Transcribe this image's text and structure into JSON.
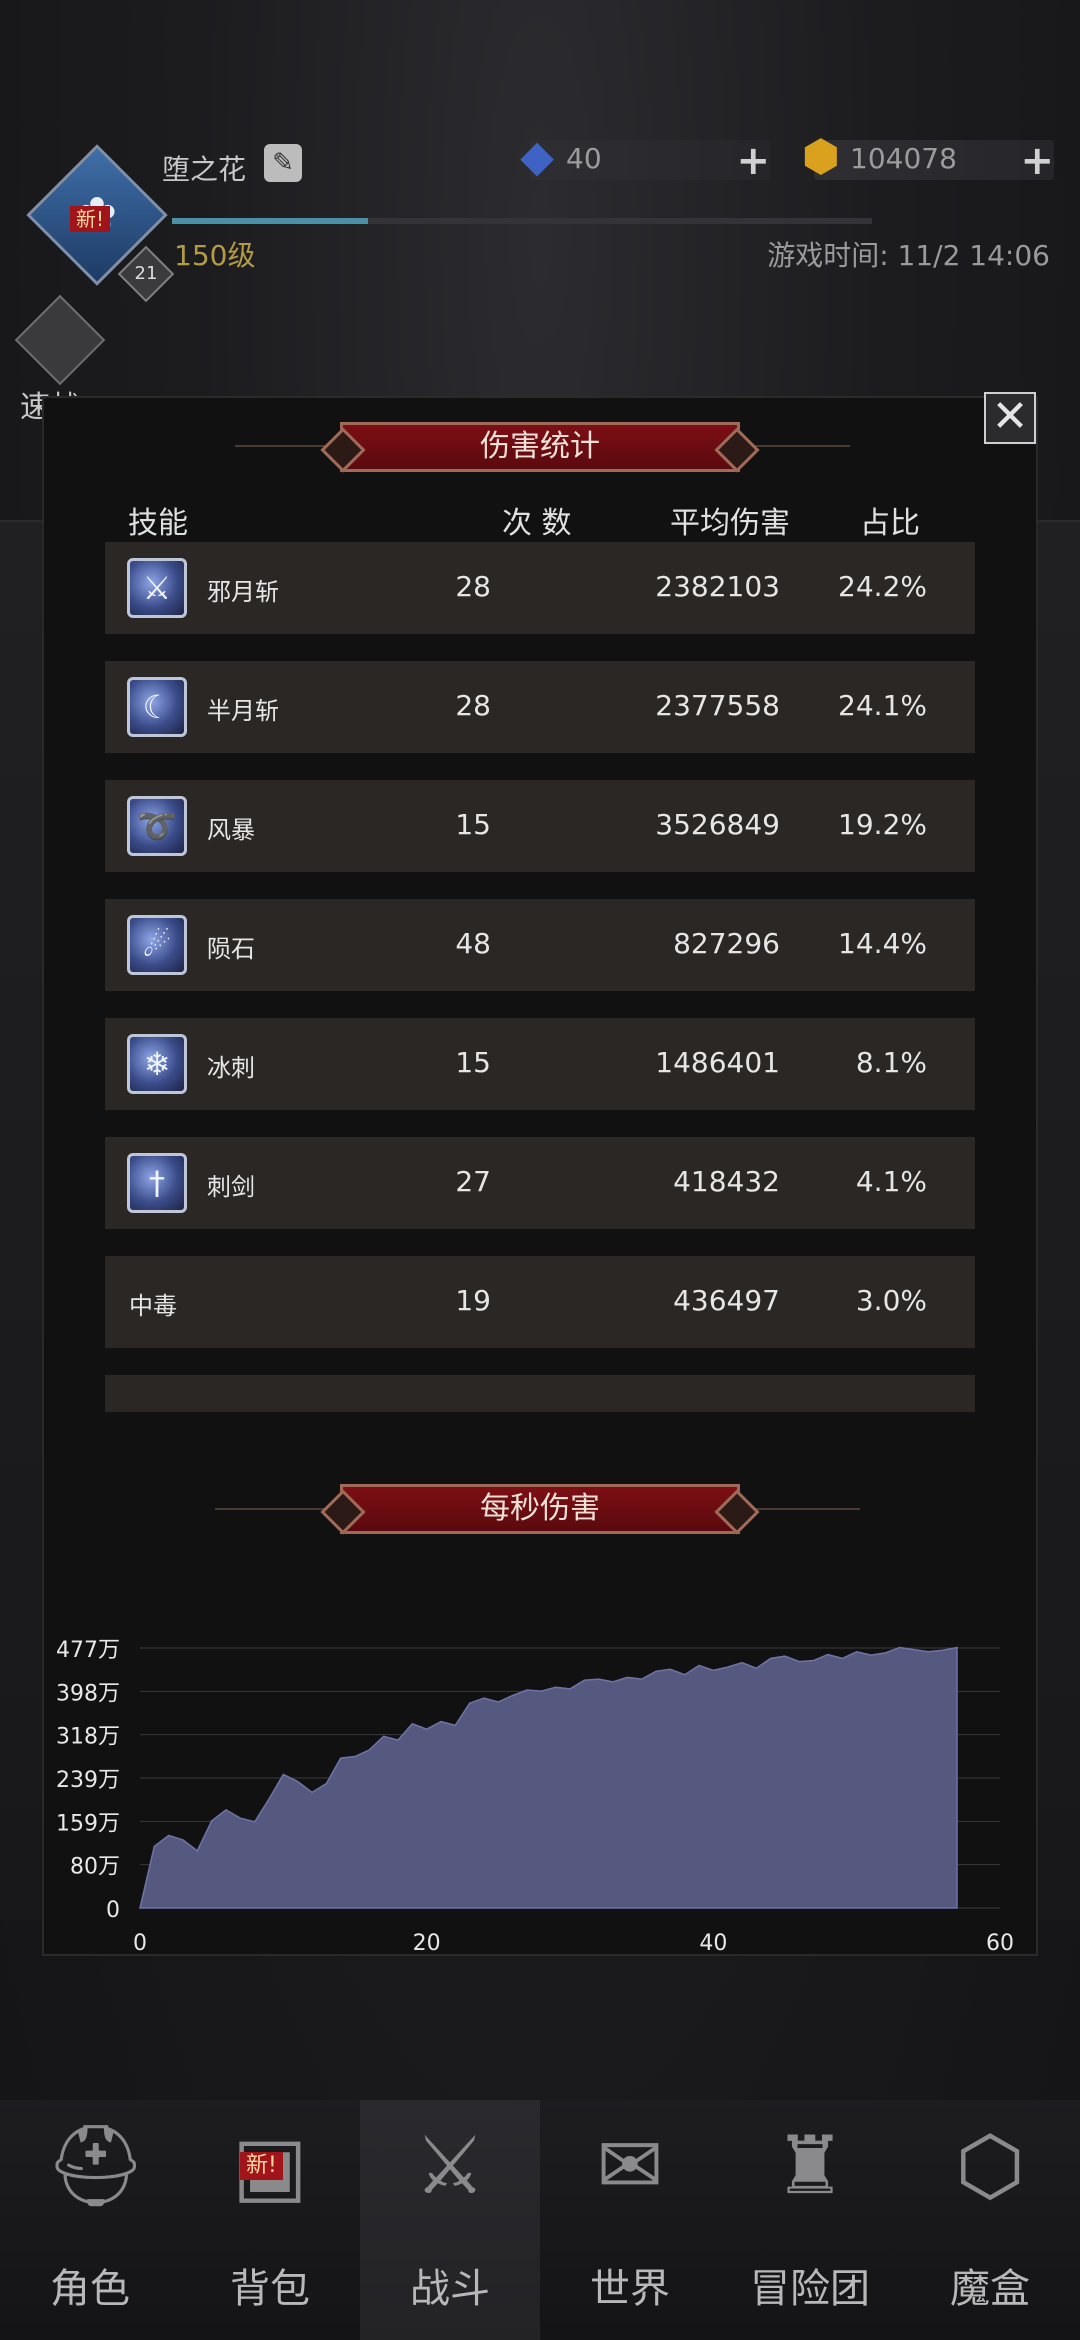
{
  "header": {
    "player_name": "堕之花",
    "player_level": "150级",
    "avatar_new_tag": "新!",
    "avatar_badge": "21",
    "exp_fraction": 0.28,
    "game_time": "游戏时间: 11/2 14:06",
    "currency": [
      {
        "icon": "blue-gem-icon",
        "amount": "40"
      },
      {
        "icon": "gold-gem-icon",
        "amount": "104078"
      }
    ],
    "speed_battle_label": "速战"
  },
  "damage_stats": {
    "title": "伤害统计",
    "columns": {
      "skill": "技能",
      "count": "次 数",
      "avg": "平均伤害",
      "pct": "占比"
    },
    "rows": [
      {
        "name": "邪月斩",
        "icon": "sword-slash-icon",
        "count": "28",
        "avg": "2382103",
        "pct": "24.2%"
      },
      {
        "name": "半月斩",
        "icon": "crescent-moon-icon",
        "count": "28",
        "avg": "2377558",
        "pct": "24.1%"
      },
      {
        "name": "风暴",
        "icon": "storm-icon",
        "count": "15",
        "avg": "3526849",
        "pct": "19.2%"
      },
      {
        "name": "陨石",
        "icon": "meteor-icon",
        "count": "48",
        "avg": "827296",
        "pct": "14.4%"
      },
      {
        "name": "冰刺",
        "icon": "ice-spike-icon",
        "count": "15",
        "avg": "1486401",
        "pct": "8.1%"
      },
      {
        "name": "刺剑",
        "icon": "rapier-icon",
        "count": "27",
        "avg": "418432",
        "pct": "4.1%"
      },
      {
        "name": "中毒",
        "icon": "",
        "count": "19",
        "avg": "436497",
        "pct": "3.0%"
      }
    ]
  },
  "dps": {
    "title": "每秒伤害"
  },
  "chart_data": {
    "type": "area",
    "title": "每秒伤害",
    "xlabel": "",
    "ylabel": "",
    "xlim": [
      0,
      60
    ],
    "ylim": [
      0,
      477
    ],
    "x_ticks": [
      "0",
      "20",
      "40",
      "60"
    ],
    "y_ticks": [
      "0",
      "80万",
      "159万",
      "239万",
      "318万",
      "398万",
      "477万"
    ],
    "grid": true,
    "series": [
      {
        "color": "#55587f",
        "x": [
          0,
          1,
          2,
          3,
          4,
          5,
          6,
          7,
          8,
          9,
          10,
          11,
          12,
          13,
          14,
          15,
          16,
          17,
          18,
          19,
          20,
          21,
          22,
          23,
          24,
          25,
          26,
          27,
          28,
          29,
          30,
          31,
          32,
          33,
          34,
          35,
          36,
          37,
          38,
          39,
          40,
          41,
          42,
          43,
          44,
          45,
          46,
          47,
          48,
          49,
          50,
          51,
          52,
          53,
          54,
          55,
          56,
          57
        ],
        "values": [
          0,
          113,
          133,
          125,
          105,
          160,
          180,
          165,
          158,
          200,
          245,
          232,
          212,
          228,
          275,
          278,
          290,
          315,
          308,
          338,
          328,
          342,
          335,
          376,
          385,
          378,
          390,
          400,
          398,
          405,
          402,
          418,
          420,
          415,
          423,
          420,
          434,
          438,
          428,
          445,
          436,
          442,
          450,
          440,
          458,
          462,
          452,
          454,
          465,
          458,
          470,
          464,
          468,
          478,
          474,
          470,
          473,
          478
        ]
      }
    ]
  },
  "nav": [
    {
      "label": "角色",
      "icon": "helmet-icon",
      "new": false,
      "active": false
    },
    {
      "label": "背包",
      "icon": "backpack-icon",
      "new": true,
      "new_tag": "新!",
      "active": false
    },
    {
      "label": "战斗",
      "icon": "shield-sword-icon",
      "new": false,
      "active": true
    },
    {
      "label": "世界",
      "icon": "map-scroll-icon",
      "new": false,
      "active": false
    },
    {
      "label": "冒险团",
      "icon": "castle-icon",
      "new": false,
      "active": false
    },
    {
      "label": "魔盒",
      "icon": "magic-box-icon",
      "new": false,
      "active": false
    }
  ]
}
